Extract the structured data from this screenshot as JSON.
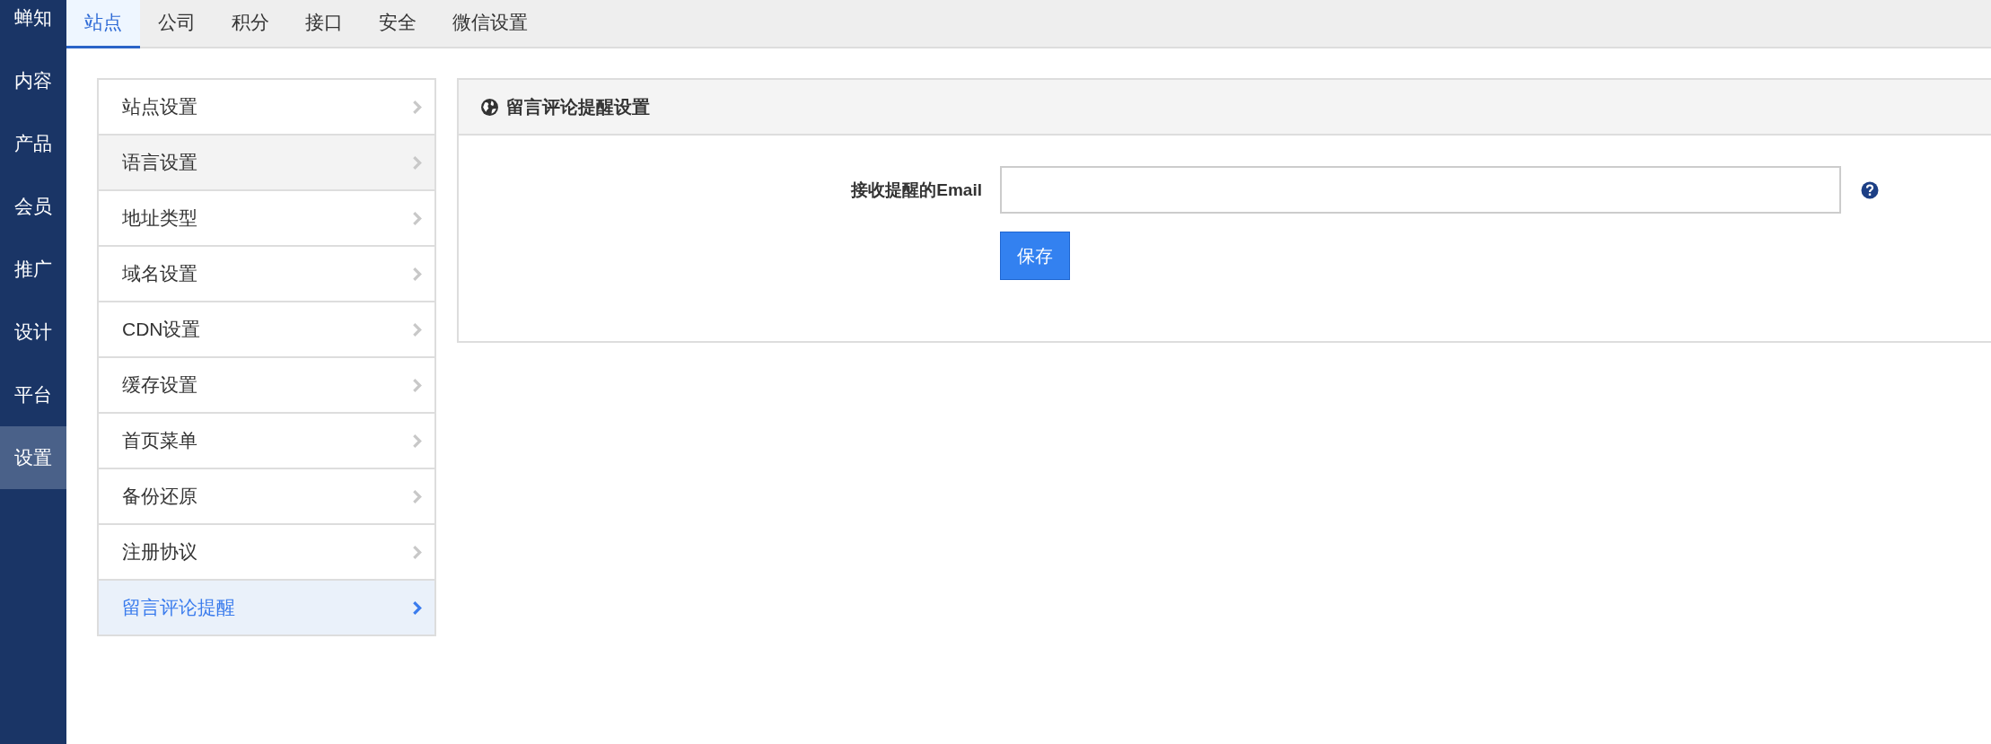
{
  "sidebar": {
    "logo": "蝉知",
    "items": [
      {
        "label": "内容",
        "selected": false
      },
      {
        "label": "产品",
        "selected": false
      },
      {
        "label": "会员",
        "selected": false
      },
      {
        "label": "推广",
        "selected": false
      },
      {
        "label": "设计",
        "selected": false
      },
      {
        "label": "平台",
        "selected": false
      },
      {
        "label": "设置",
        "selected": true
      }
    ]
  },
  "tabs": [
    {
      "label": "站点",
      "selected": true
    },
    {
      "label": "公司",
      "selected": false
    },
    {
      "label": "积分",
      "selected": false
    },
    {
      "label": "接口",
      "selected": false
    },
    {
      "label": "安全",
      "selected": false
    },
    {
      "label": "微信设置",
      "selected": false
    }
  ],
  "menu": [
    {
      "label": "站点设置",
      "selected": false,
      "hovered": false
    },
    {
      "label": "语言设置",
      "selected": false,
      "hovered": true
    },
    {
      "label": "地址类型",
      "selected": false,
      "hovered": false
    },
    {
      "label": "域名设置",
      "selected": false,
      "hovered": false
    },
    {
      "label": "CDN设置",
      "selected": false,
      "hovered": false
    },
    {
      "label": "缓存设置",
      "selected": false,
      "hovered": false
    },
    {
      "label": "首页菜单",
      "selected": false,
      "hovered": false
    },
    {
      "label": "备份还原",
      "selected": false,
      "hovered": false
    },
    {
      "label": "注册协议",
      "selected": false,
      "hovered": false
    },
    {
      "label": "留言评论提醒",
      "selected": true,
      "hovered": false
    }
  ],
  "panel": {
    "title": "留言评论提醒设置",
    "field_label": "接收提醒的Email",
    "save_button": "保存"
  }
}
